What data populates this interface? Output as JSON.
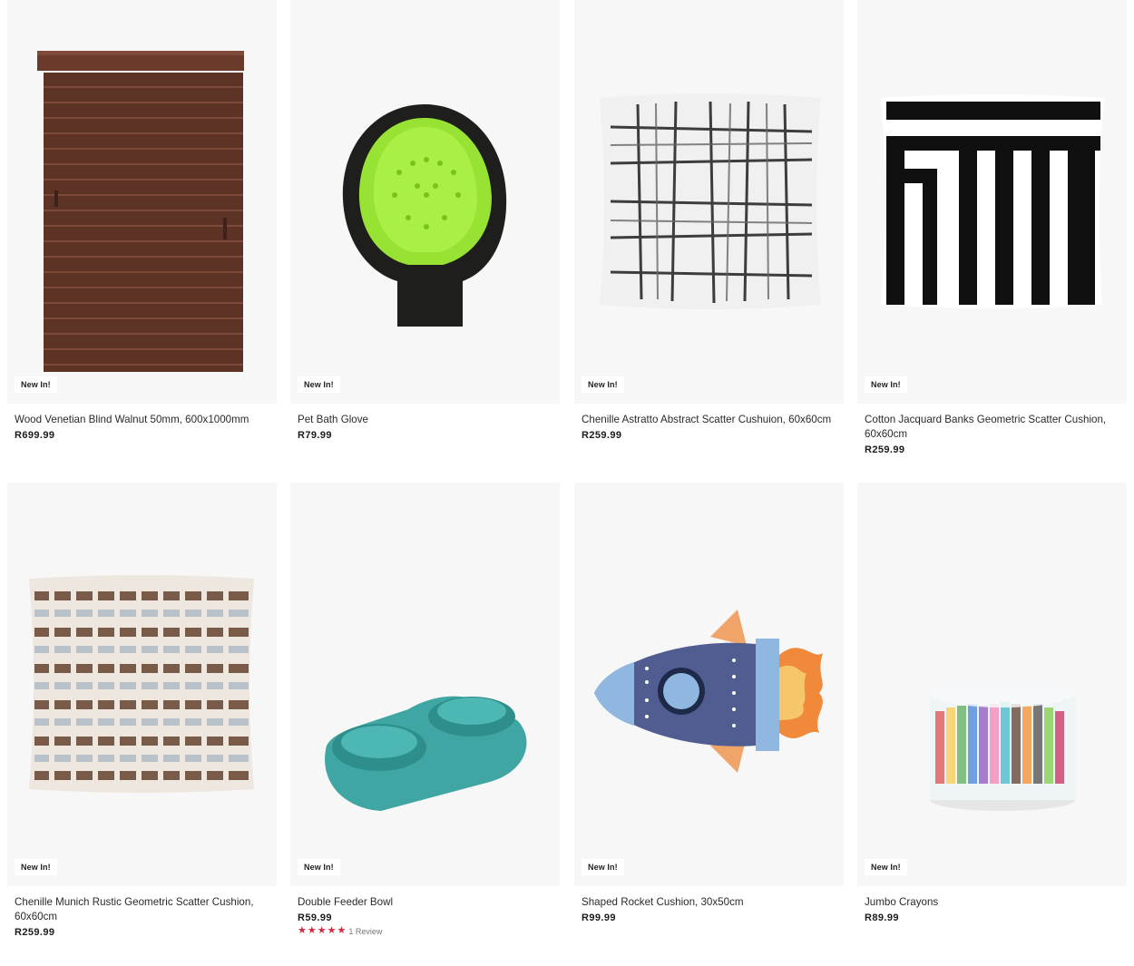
{
  "products": [
    {
      "title": "Wood Venetian Blind Walnut 50mm, 600x1000mm",
      "price": "R699.99",
      "badge": "New In!",
      "image": "venetian-blind"
    },
    {
      "title": "Pet Bath Glove",
      "price": "R79.99",
      "badge": "New In!",
      "image": "bath-glove"
    },
    {
      "title": "Chenille Astratto Abstract Scatter Cushuion, 60x60cm",
      "price": "R259.99",
      "badge": "New In!",
      "image": "abstract-cushion"
    },
    {
      "title": "Cotton Jacquard Banks Geometric Scatter Cushion, 60x60cm",
      "price": "R259.99",
      "badge": "New In!",
      "image": "geometric-cushion"
    },
    {
      "title": "Chenille Munich Rustic Geometric Scatter Cushion, 60x60cm",
      "price": "R259.99",
      "badge": "New In!",
      "image": "rustic-cushion"
    },
    {
      "title": "Double Feeder Bowl",
      "price": "R59.99",
      "badge": "New In!",
      "image": "feeder-bowl",
      "rating": {
        "stars": 5,
        "label": "1 Review"
      }
    },
    {
      "title": "Shaped Rocket Cushion, 30x50cm",
      "price": "R99.99",
      "badge": "New In!",
      "image": "rocket-cushion"
    },
    {
      "title": "Jumbo Crayons",
      "price": "R89.99",
      "badge": "New In!",
      "image": "crayons"
    }
  ],
  "colors": {
    "star": "#d32a3c",
    "image_bg": "#f7f7f7"
  }
}
